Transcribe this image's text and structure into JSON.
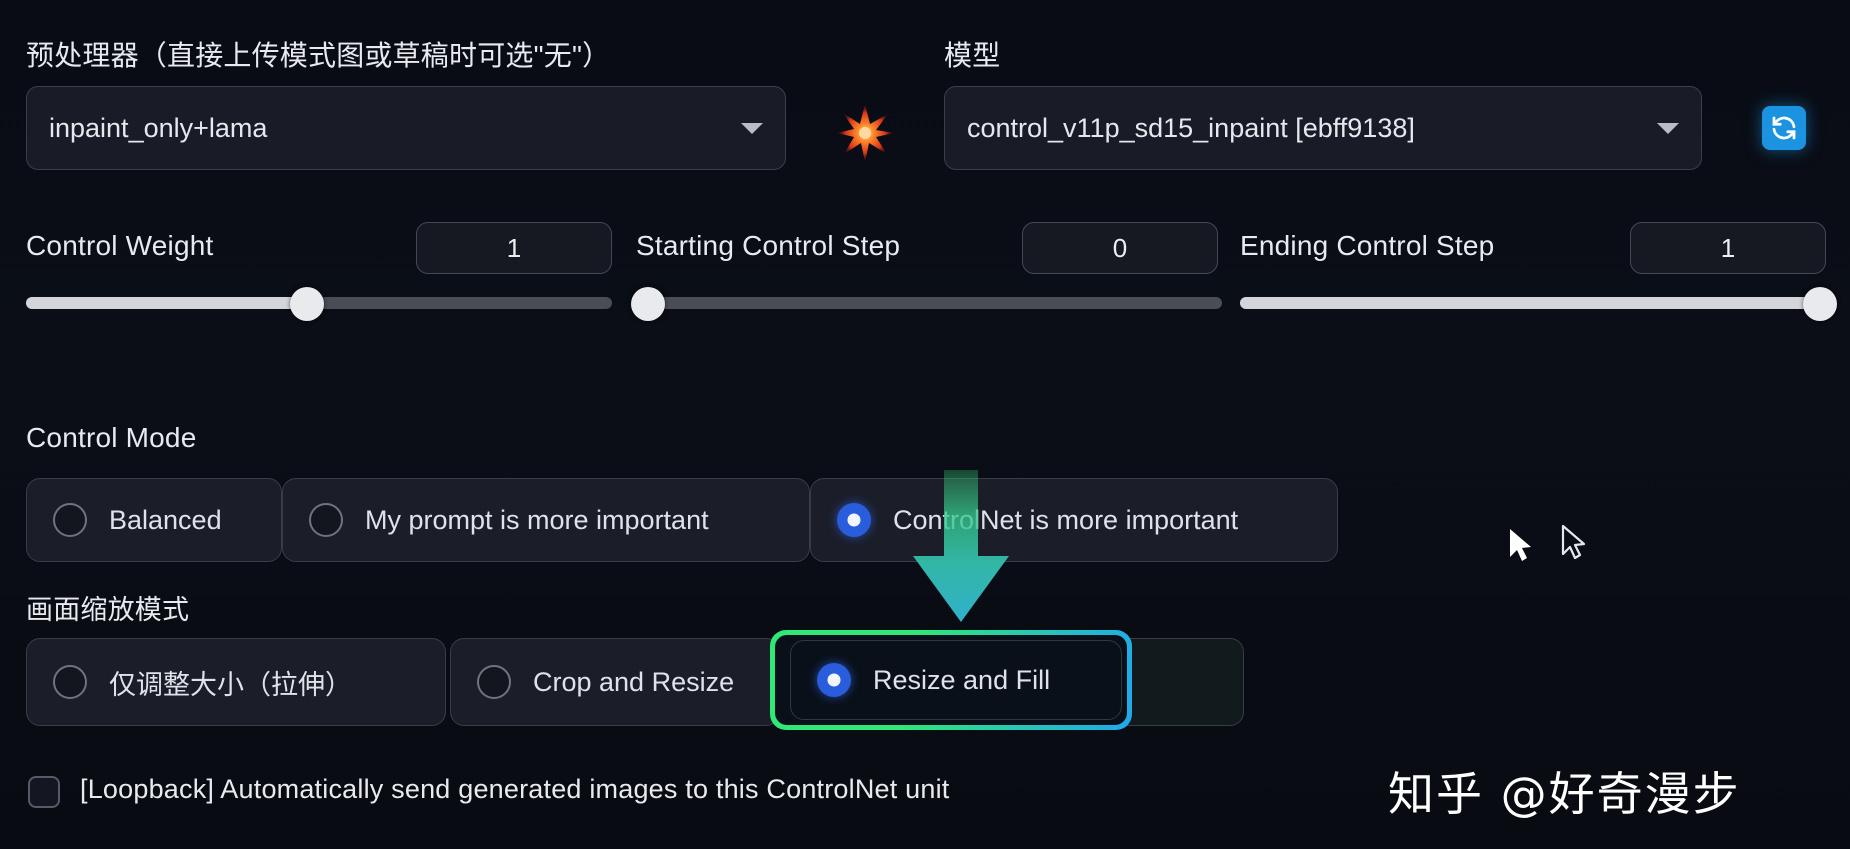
{
  "preprocessor": {
    "label": "预处理器（直接上传模式图或草稿时可选\"无\"）",
    "value": "inpaint_only+lama"
  },
  "model": {
    "label": "模型",
    "value": "control_v11p_sd15_inpaint [ebff9138]"
  },
  "icons": {
    "refresh": "refresh-icon",
    "sparkle": "sparkle-icon",
    "caret": "chevron-down-icon"
  },
  "sliders": [
    {
      "label": "Control Weight",
      "value": "1",
      "percent": 48
    },
    {
      "label": "Starting Control Step",
      "value": "0",
      "percent": 0
    },
    {
      "label": "Ending Control Step",
      "value": "1",
      "percent": 100
    }
  ],
  "control_mode": {
    "label": "Control Mode",
    "options": [
      {
        "label": "Balanced",
        "selected": false
      },
      {
        "label": "My prompt is more important",
        "selected": false
      },
      {
        "label": "ControlNet is more important",
        "selected": true
      }
    ]
  },
  "resize_mode": {
    "label": "画面缩放模式",
    "options": [
      {
        "label": "仅调整大小（拉伸）",
        "selected": false
      },
      {
        "label": "Crop and Resize",
        "selected": false
      },
      {
        "label": "Resize and Fill",
        "selected": true
      }
    ]
  },
  "loopback": {
    "label": "[Loopback] Automatically send generated images to this ControlNet unit",
    "checked": false
  },
  "annotations": {
    "highlight_color_start": "#2ee877",
    "highlight_color_end": "#1fa9ec",
    "arrow_color_top": "#3bd17d",
    "arrow_color_bottom": "#33b4cb"
  },
  "watermark": {
    "text": "知乎 @好奇漫步"
  }
}
